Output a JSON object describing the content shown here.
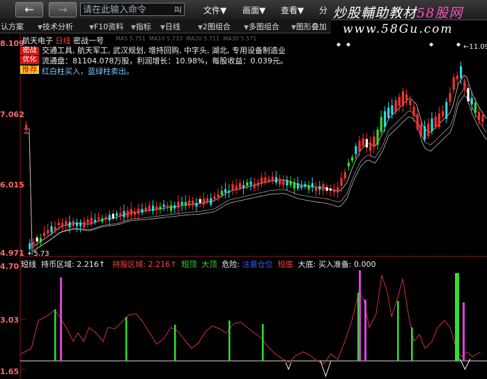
{
  "toolbar": {
    "back_label": "←",
    "forward_label": "→",
    "command_placeholder": "请在此输入命令",
    "command_suffix": "叫",
    "menus": [
      "文件▼",
      "画面▼",
      "查看▼",
      "分"
    ],
    "brand": "炒股輔助教材",
    "brand_accent": "58股网",
    "site": "www.58Gu.com"
  },
  "tabs": [
    "认方案",
    "技术分析",
    "F10资料",
    "指标",
    "日线",
    "2图组合",
    "多图组合",
    "图形叠加"
  ],
  "stock": {
    "name": "航天电子",
    "period": "日线",
    "title": "密战一号",
    "ma_labels": [
      "MA5",
      "MA10",
      "MA20",
      "MA30"
    ],
    "ma_values": [
      "5.751",
      "5.733",
      "5.711",
      "5.571"
    ]
  },
  "badges": [
    "密战",
    "优化",
    "推荐"
  ],
  "info_lines": [
    "交通工具, 航天军工, 武汉规划, 增持回购, 中字头, 湖北, 专用设备制造业",
    "流通盘：81104.078万股，利润增长：10.98%，每股收益：0.039元。",
    "红白柱买入，蓝绿柱卖出。"
  ],
  "price_axis": [
    "8.109",
    "7.062",
    "6.015",
    "4.971"
  ],
  "low_label": "5.73",
  "high_label": "11.09",
  "indicator": {
    "name": "短线",
    "field1_label": "持币区域:",
    "field1_value": "2.216↑",
    "field2_label": "持股区域:",
    "field2_value": "2.216↑",
    "short_top": "短顶",
    "big_top": "大顶",
    "danger": "危险:",
    "danger_value": "注意仓位",
    "short_bottom": "短底",
    "big_bottom_label": "大底:",
    "ready_label": "买入准备:",
    "ready_value": "0.000"
  },
  "indicator_axis": [
    "4.70",
    "3.03",
    "1.65"
  ],
  "colors": {
    "up": "#ff3030",
    "down": "#30d8e0",
    "green_bar": "#30e030",
    "magenta_bar": "#e040e0",
    "line": "#d03050"
  }
}
